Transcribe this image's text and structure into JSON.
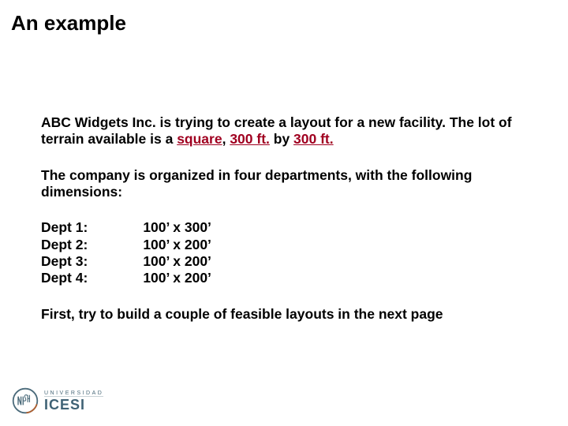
{
  "title": "An example",
  "intro_prefix": "ABC Widgets Inc. is trying to create a layout for a new facility. The  lot of terrain available is a ",
  "intro_kw1": "square",
  "intro_mid1": ", ",
  "intro_kw2": "300 ft.",
  "intro_mid2": " by ",
  "intro_kw3": "300 ft.",
  "org_line": "The company is organized in four departments, with the following dimensions:",
  "depts": [
    {
      "label": "Dept 1:",
      "dim": "100’ x 300’"
    },
    {
      "label": "Dept 2:",
      "dim": "100’ x 200’"
    },
    {
      "label": "Dept 3:",
      "dim": "100’ x 200’"
    },
    {
      "label": "Dept 4:",
      "dim": "100’ x 200’"
    }
  ],
  "closing": "First, try to build a couple of feasible layouts in the next page",
  "logo": {
    "small": "UNIVERSIDAD",
    "big": "ICESI"
  }
}
